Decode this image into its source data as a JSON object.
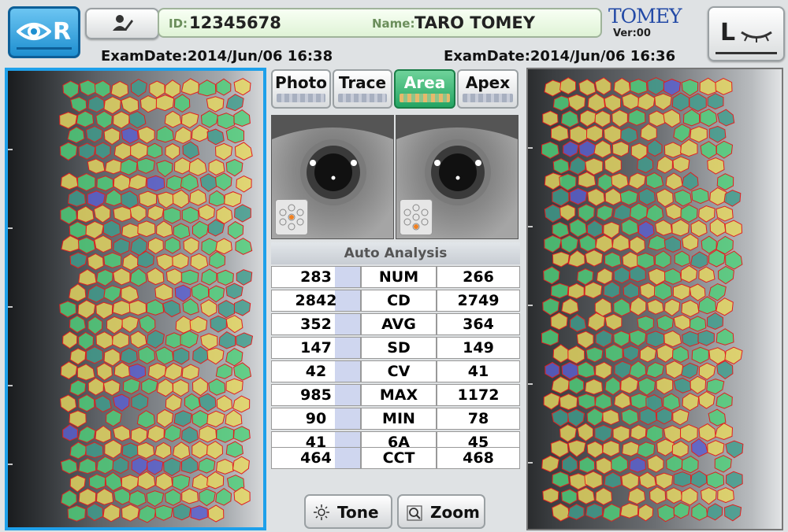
{
  "header": {
    "right_eye_label": "R",
    "id_label": "ID:",
    "id_value": "12345678",
    "name_label": "Name:",
    "name_value": "TARO TOMEY",
    "brand": "TOMEY",
    "version": "Ver:00",
    "left_eye_label": "L"
  },
  "exam_dates": {
    "right": "ExamDate:2014/Jun/06 16:38",
    "left": "ExamDate:2014/Jun/06 16:36"
  },
  "tabs": [
    {
      "label": "Photo",
      "active": false
    },
    {
      "label": "Trace",
      "active": false
    },
    {
      "label": "Area",
      "active": true
    },
    {
      "label": "Apex",
      "active": false
    }
  ],
  "analysis": {
    "title": "Auto Analysis",
    "rows": [
      {
        "right": "283",
        "metric": "NUM",
        "left": "266"
      },
      {
        "right": "2842",
        "metric": "CD",
        "left": "2749"
      },
      {
        "right": "352",
        "metric": "AVG",
        "left": "364"
      },
      {
        "right": "147",
        "metric": "SD",
        "left": "149"
      },
      {
        "right": "42",
        "metric": "CV",
        "left": "41"
      },
      {
        "right": "985",
        "metric": "MAX",
        "left": "1172"
      },
      {
        "right": "90",
        "metric": "MIN",
        "left": "78"
      },
      {
        "right": "41",
        "metric": "6A",
        "left": "45"
      }
    ],
    "cct": {
      "right": "464",
      "metric": "CCT",
      "left": "468"
    }
  },
  "buttons": {
    "tone": "Tone",
    "zoom": "Zoom"
  },
  "colors": {
    "active_eye": "#1e8fd0",
    "active_tab": "#24a463",
    "cell_outline": "#e02020",
    "cell_green": "#4fd07a",
    "cell_yellow": "#e6d860",
    "cell_teal": "#3f9c8c",
    "cell_blue": "#5a5fd0"
  }
}
